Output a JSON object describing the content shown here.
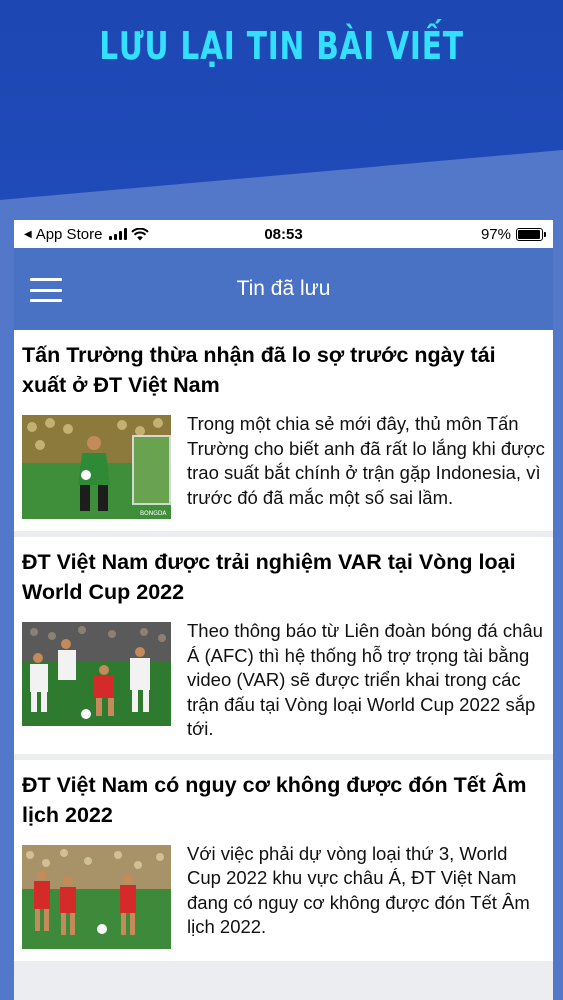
{
  "promo": {
    "title": "LƯU LẠI TIN BÀI VIẾT"
  },
  "status_bar": {
    "carrier": "App Store",
    "time": "08:53",
    "battery": "97%",
    "battery_level": 0.97
  },
  "nav": {
    "title": "Tin đã lưu",
    "menu_icon": "hamburger-menu-icon"
  },
  "articles": [
    {
      "title": "Tấn Trường thừa nhận đã lo sợ trước ngày tái xuất ở ĐT Việt Nam",
      "summary": "Trong một chia sẻ mới đây, thủ môn Tấn Trường cho biết anh đã rất lo lắng khi được trao suất bắt chính ở trận gặp Indonesia, vì trước đó đã mắc một số sai lầm.",
      "thumbnail": "goalkeeper-photo"
    },
    {
      "title": "ĐT Việt Nam được trải nghiệm VAR tại Vòng loại World Cup 2022",
      "summary": "Theo thông báo từ Liên đoàn bóng đá châu Á (AFC) thì hệ thống hỗ trợ trọng tài bằng video (VAR) sẽ được triển khai trong các trận đấu tại Vòng loại World Cup 2022 sắp tới.",
      "thumbnail": "match-action-photo"
    },
    {
      "title": "ĐT Việt Nam có nguy cơ không được đón Tết Âm lịch 2022",
      "summary": "Với việc phải dự vòng loại thứ 3, World Cup 2022 khu vực châu Á, ĐT Việt Nam đang có nguy cơ không được đón Tết Âm lịch 2022.",
      "thumbnail": "team-players-photo"
    }
  ],
  "colors": {
    "promo_dark": "#1f4bb8",
    "promo_title": "#34e0ff",
    "nav_bg": "#4a72c4"
  }
}
